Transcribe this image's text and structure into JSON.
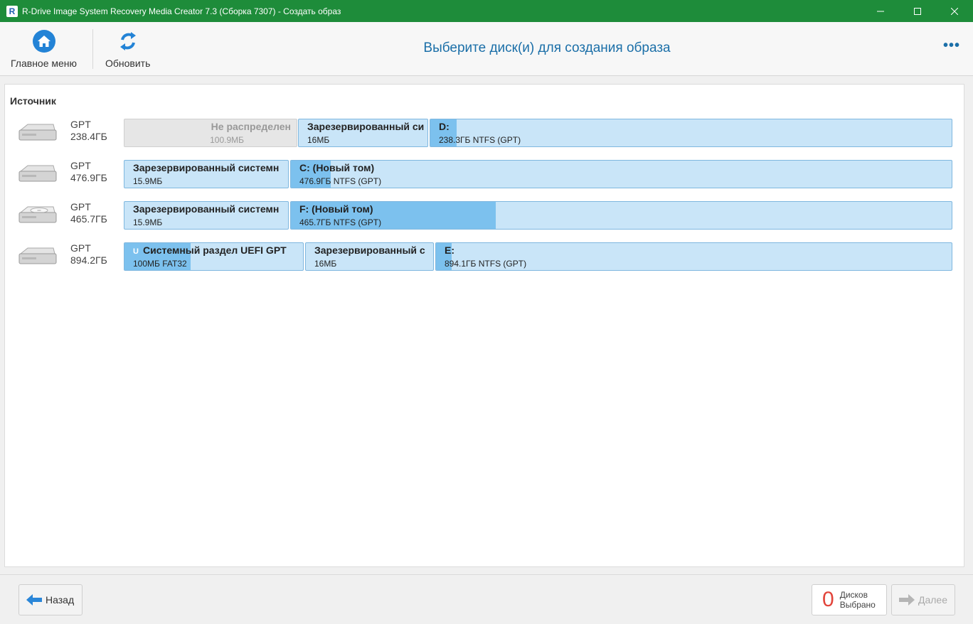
{
  "window": {
    "title": "R-Drive Image System Recovery Media Creator 7.3 (Сборка 7307) - Создать образ",
    "app_icon_letter": "R"
  },
  "toolbar": {
    "home_label": "Главное меню",
    "refresh_label": "Обновить",
    "page_title": "Выберите диск(и) для создания образа",
    "more_label": "•••"
  },
  "source": {
    "title": "Источник",
    "disks": [
      {
        "type": "GPT",
        "size": "238.4ГБ",
        "partitions": [
          {
            "name": "Не распределен",
            "info": "100.9МБ",
            "unallocated": true
          },
          {
            "name": "Зарезервированный си",
            "info": "16МБ",
            "fill": 0
          },
          {
            "name": "D:",
            "info": "238.3ГБ NTFS (GPT)",
            "fill": 0.05
          }
        ]
      },
      {
        "type": "GPT",
        "size": "476.9ГБ",
        "partitions": [
          {
            "name": "Зарезервированный системн",
            "info": "15.9МБ",
            "fill": 0
          },
          {
            "name": "C: (Новый том)",
            "info": "476.9ГБ NTFS (GPT)",
            "fill": 0.06
          }
        ]
      },
      {
        "type": "GPT",
        "size": "465.7ГБ",
        "partitions": [
          {
            "name": "Зарезервированный системн",
            "info": "15.9МБ",
            "fill": 0
          },
          {
            "name": "F: (Новый том)",
            "info": "465.7ГБ NTFS (GPT)",
            "fill": 0.31
          }
        ]
      },
      {
        "type": "GPT",
        "size": "894.2ГБ",
        "partitions": [
          {
            "name": "Системный раздел UEFI GPT",
            "info": "100МБ FAT32",
            "fill": 0.37,
            "badge": "U"
          },
          {
            "name": "Зарезервированный с",
            "info": "16МБ",
            "fill": 0
          },
          {
            "name": "E:",
            "info": "894.1ГБ NTFS (GPT)",
            "fill": 0.03
          }
        ]
      }
    ]
  },
  "footer": {
    "back_label": "Назад",
    "selected_count": "0",
    "selected_line1": "Дисков",
    "selected_line2": "Выбрано",
    "next_label": "Далее"
  }
}
